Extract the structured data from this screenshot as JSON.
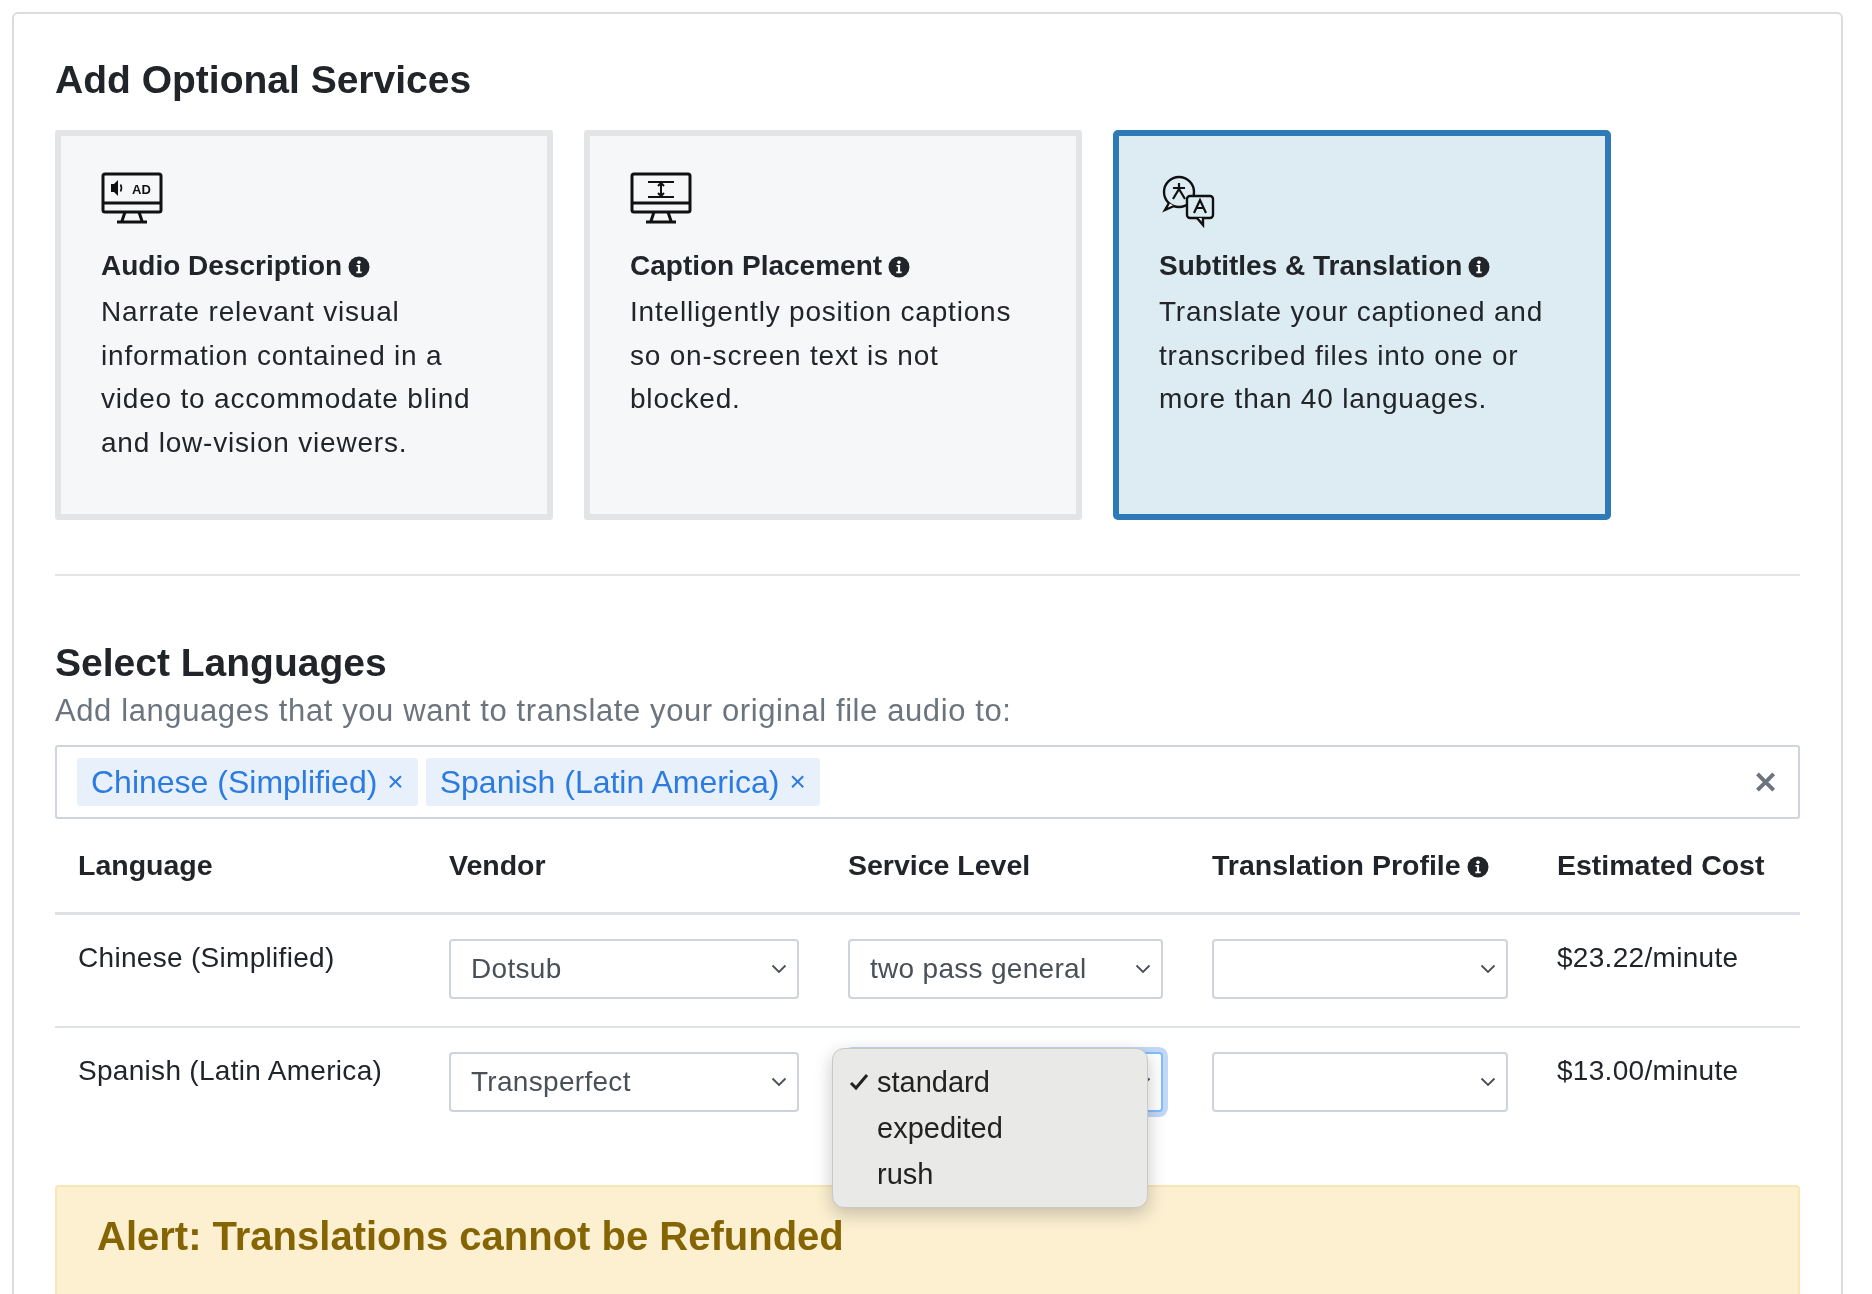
{
  "services": {
    "title": "Add Optional Services",
    "cards": [
      {
        "kind": "audio",
        "icon_label": "AD",
        "title": "Audio Description",
        "description": "Narrate relevant visual information contained in a video to accommodate blind and low-vision viewers.",
        "selected": false
      },
      {
        "kind": "caption",
        "title": "Caption Placement",
        "description": "Intelligently position captions so on-screen text is not blocked.",
        "selected": false
      },
      {
        "kind": "translate",
        "title": "Subtitles & Translation",
        "description": "Translate your captioned and transcribed files into one or more than 40 languages.",
        "selected": true
      }
    ]
  },
  "languages": {
    "title": "Select Languages",
    "subtitle": "Add languages that you want to translate your original file audio to:",
    "tags": [
      {
        "label": "Chinese (Simplified)",
        "remove": "×"
      },
      {
        "label": "Spanish (Latin America)",
        "remove": "×"
      }
    ],
    "clear": "✕",
    "columns": [
      {
        "label": "Language",
        "info": false
      },
      {
        "label": "Vendor",
        "info": false
      },
      {
        "label": "Service Level",
        "info": false
      },
      {
        "label": "Translation Profile",
        "info": true
      },
      {
        "label": "Estimated Cost",
        "info": false
      }
    ],
    "rows": [
      {
        "language": "Chinese (Simplified)",
        "vendor": "Dotsub",
        "service_level": {
          "value": "two pass general",
          "open": false
        },
        "profile": "",
        "cost": "$23.22/minute"
      },
      {
        "language": "Spanish (Latin America)",
        "vendor": "Transperfect",
        "service_level": {
          "open": true,
          "options": [
            {
              "label": "standard",
              "selected": true
            },
            {
              "label": "expedited",
              "selected": false
            },
            {
              "label": "rush",
              "selected": false
            }
          ]
        },
        "profile": "",
        "cost": "$13.00/minute"
      }
    ]
  },
  "alert": {
    "title": "Alert: Translations cannot be Refunded"
  }
}
